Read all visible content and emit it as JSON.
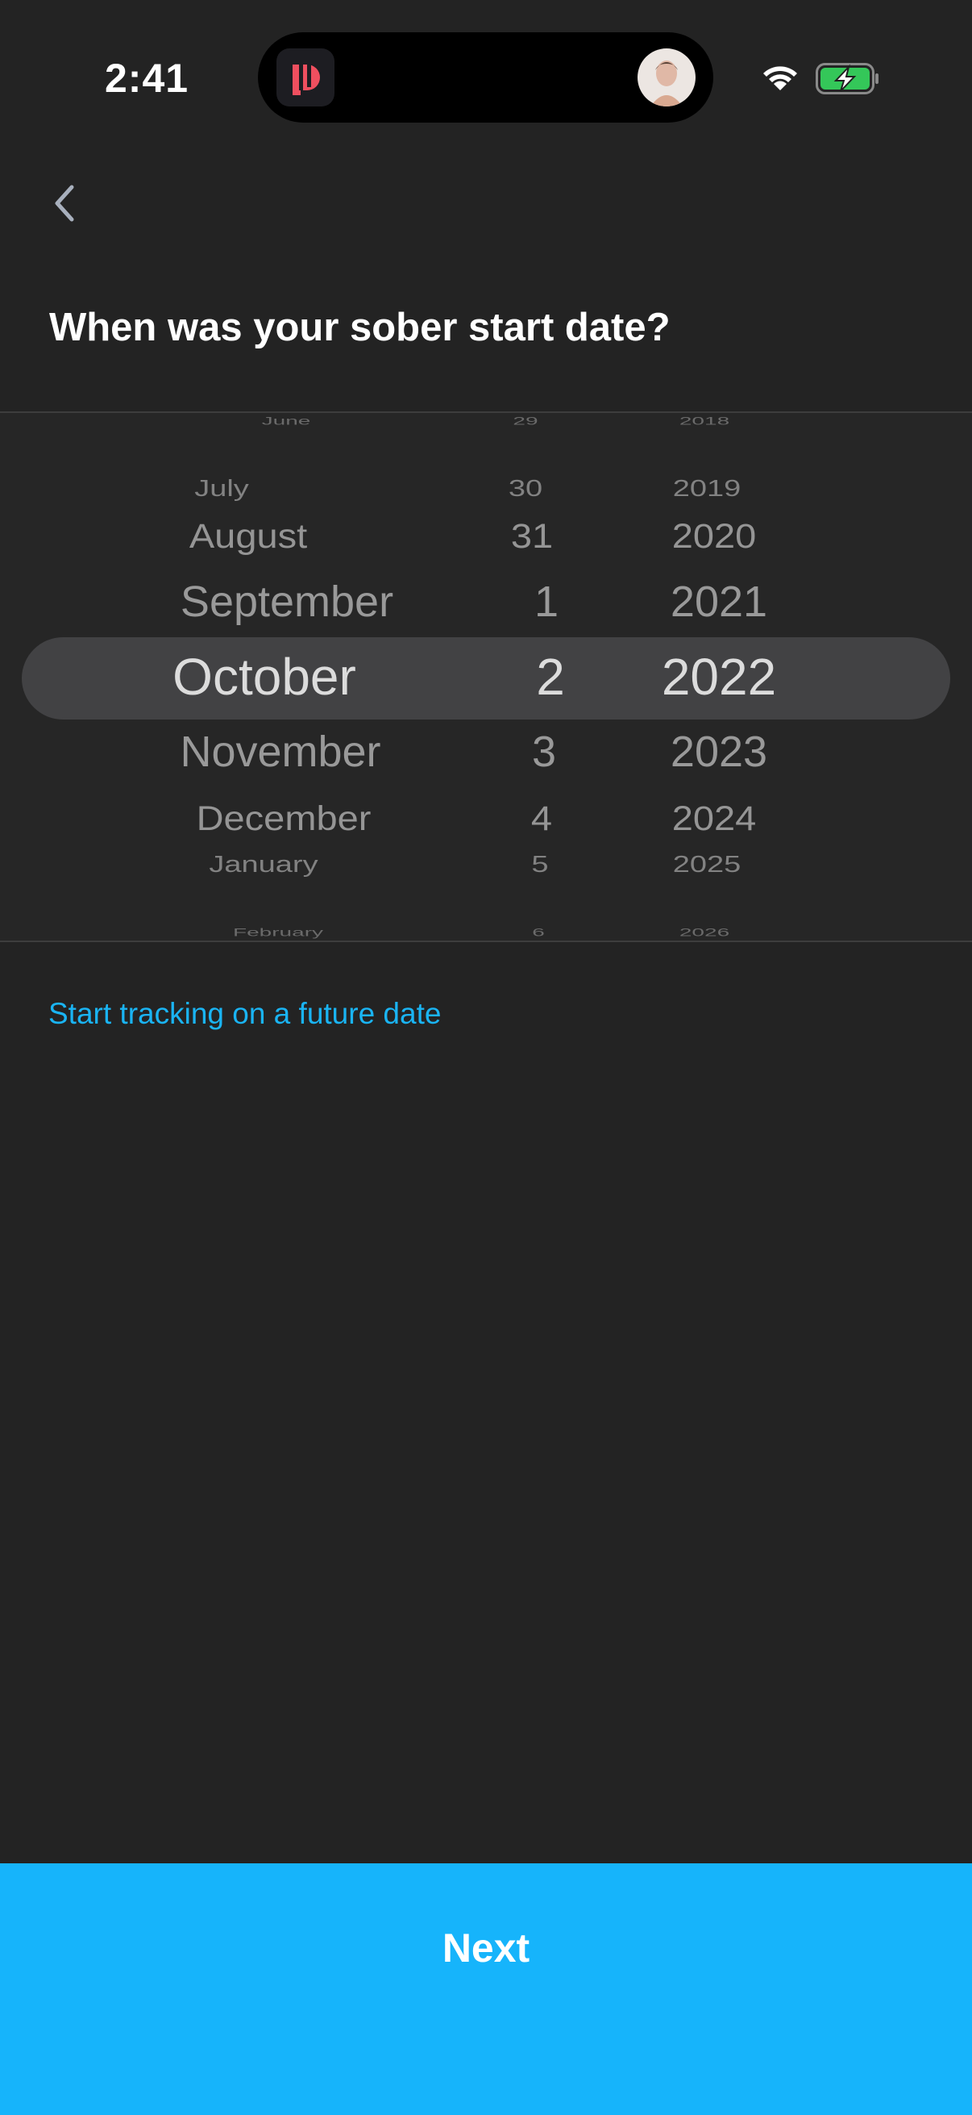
{
  "status_bar": {
    "time": "2:41",
    "icons": [
      "app-icon",
      "avatar",
      "wifi-icon",
      "battery-charging-icon"
    ],
    "battery_color": "#34c759"
  },
  "header": {
    "back_icon": "chevron-left-icon",
    "title": "When was your sober start date?"
  },
  "date_picker": {
    "month_column": [
      "June",
      "July",
      "August",
      "September",
      "October",
      "November",
      "December",
      "January",
      "February"
    ],
    "day_column": [
      "29",
      "30",
      "31",
      "1",
      "2",
      "3",
      "4",
      "5",
      "6"
    ],
    "year_column": [
      "2018",
      "2019",
      "2020",
      "2021",
      "2022",
      "2023",
      "2024",
      "2025",
      "2026"
    ],
    "selected": {
      "month": "October",
      "day": "2",
      "year": "2022"
    }
  },
  "future_link": "Start tracking on a future date",
  "next_button": "Next",
  "colors": {
    "background": "#232323",
    "accent": "#16b4fb",
    "link": "#1ab4f3",
    "highlight": "#424244"
  }
}
